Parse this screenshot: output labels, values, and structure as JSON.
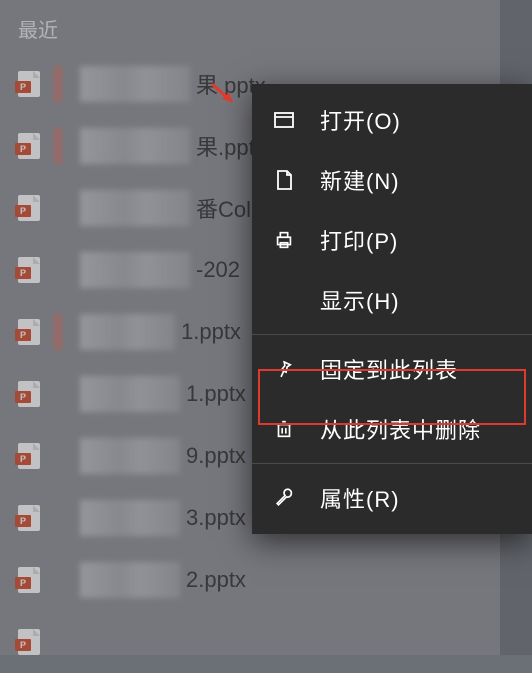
{
  "section": {
    "title": "最近"
  },
  "files": [
    {
      "tail": "果.pptx"
    },
    {
      "tail": "果.pptx"
    },
    {
      "tail": "番Col"
    },
    {
      "tail": "-202"
    },
    {
      "tail": "1.pptx"
    },
    {
      "tail": "1.pptx"
    },
    {
      "tail": "9.pptx"
    },
    {
      "tail": "3.pptx"
    },
    {
      "tail": "2.pptx"
    },
    {
      "tail": ""
    }
  ],
  "menu": {
    "open": "打开(O)",
    "new": "新建(N)",
    "print": "打印(P)",
    "show": "显示(H)",
    "pin": "固定到此列表",
    "remove": "从此列表中删除",
    "props": "属性(R)"
  },
  "icon_badge": "P",
  "annotation": {
    "highlight_color": "#e03a2f"
  }
}
